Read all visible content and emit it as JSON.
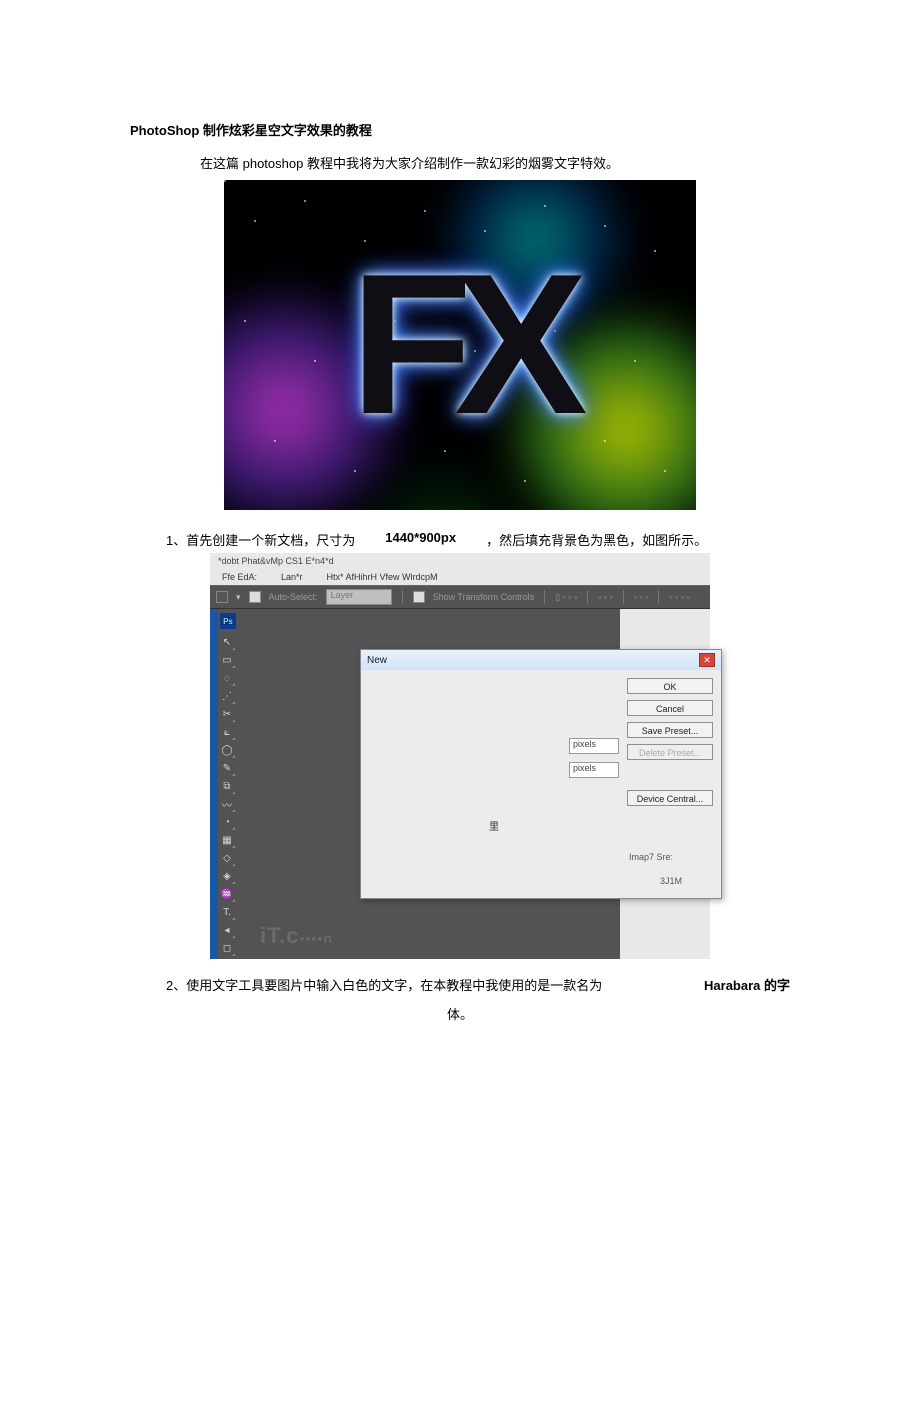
{
  "title": "PhotoShop 制作炫彩星空文字效果的教程",
  "intro": "在这篇 photoshop 教程中我将为大家介绍制作一款幻彩的烟雾文字特效。",
  "hero_text": "FX",
  "step1": {
    "prefix": "1、首先创建一个新文档，尺寸为",
    "size": "1440*900px",
    "suffix": "，然后填充背景色为黑色，如图所示。"
  },
  "step2": {
    "prefix": "2、使用文字工具要图片中输入白色的文字，在本教程中我使用的是一款名为",
    "fontname": "Harabara 的字",
    "suffix": "体。"
  },
  "ps": {
    "titlebar": "*dobt Phat&vMp CS1 E*n4*d",
    "menu": {
      "file": "Ffe EdA:",
      "layer": "Lan*r",
      "rest": "Htx* AfHihrH Vfew WlrdcpM"
    },
    "options": {
      "autoselect": "Auto-Select:",
      "layer": "Layer",
      "showtransform": "Show Transform Controls",
      "cluster1": "␣␣ ␣ ␣␣",
      "cluster2": "▭ ▭ ▭",
      "cluster3": "␣␣ ␣ ␣",
      "cluster4": "␣"
    },
    "tool_logo": "Ps",
    "tools": [
      "↖",
      "▭",
      "◌",
      "⋰",
      "✂",
      "⟀",
      "◯",
      "✎",
      "⧉",
      "〰",
      "◔",
      "▦",
      "◇",
      "◈",
      "♒",
      "T.",
      "◂",
      "◻"
    ],
    "watermark_main": "iT.c",
    "watermark_sub": "n",
    "dialog": {
      "title": "New",
      "unit1": "pixels",
      "unit2": "pixels",
      "label_li": "里",
      "ok": "OK",
      "cancel": "Cancel",
      "savepreset": "Save Preset...",
      "deletepreset": "Delete Preset...",
      "devicecentral": "Device Central...",
      "info1": "Imap7 Sre:",
      "info2": "3J1M"
    }
  }
}
